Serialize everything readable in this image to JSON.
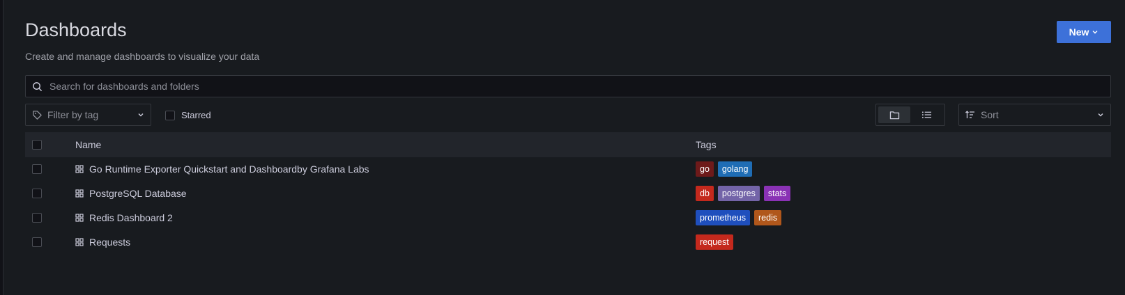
{
  "header": {
    "title": "Dashboards",
    "subtitle": "Create and manage dashboards to visualize your data",
    "new_label": "New"
  },
  "search": {
    "placeholder": "Search for dashboards and folders"
  },
  "filter": {
    "label": "Filter by tag"
  },
  "starred": {
    "label": "Starred"
  },
  "sort": {
    "label": "Sort"
  },
  "table": {
    "headers": {
      "name": "Name",
      "tags": "Tags"
    },
    "rows": [
      {
        "name": "Go Runtime Exporter Quickstart and Dashboardby Grafana Labs",
        "tags": [
          {
            "label": "go",
            "color": "#6e1a1a"
          },
          {
            "label": "golang",
            "color": "#1f6db5"
          }
        ]
      },
      {
        "name": "PostgreSQL Database",
        "tags": [
          {
            "label": "db",
            "color": "#c4291d"
          },
          {
            "label": "postgres",
            "color": "#7364a8"
          },
          {
            "label": "stats",
            "color": "#8a32b5"
          }
        ]
      },
      {
        "name": "Redis Dashboard 2",
        "tags": [
          {
            "label": "prometheus",
            "color": "#1f4fbd"
          },
          {
            "label": "redis",
            "color": "#b0571b"
          }
        ]
      },
      {
        "name": "Requests",
        "tags": [
          {
            "label": "request",
            "color": "#c4291d"
          }
        ]
      }
    ]
  }
}
